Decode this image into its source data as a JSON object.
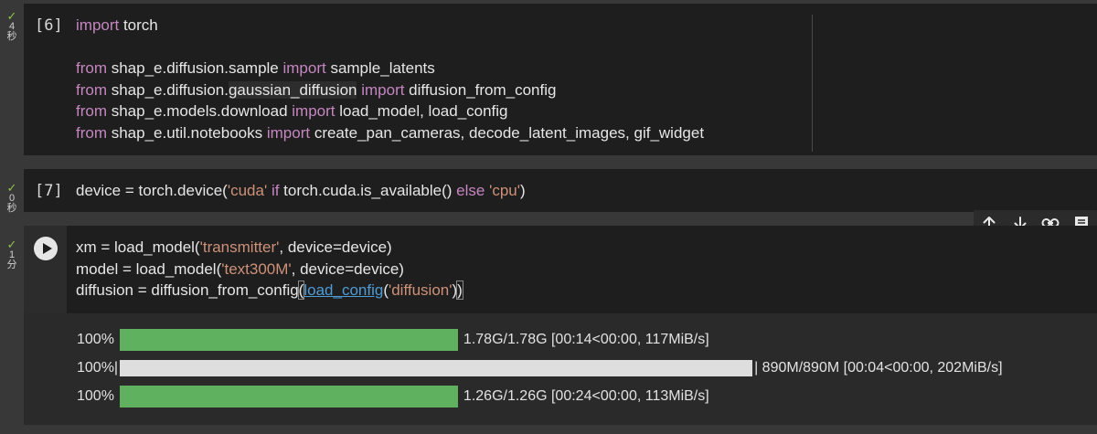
{
  "cells": [
    {
      "prompt": "[6]",
      "status": {
        "time": "4",
        "unit": "秒"
      },
      "lines": [
        [
          [
            "kw",
            "import"
          ],
          [
            "txt",
            " torch"
          ]
        ],
        [],
        [
          [
            "kw",
            "from"
          ],
          [
            "txt",
            " shap_e.diffusion.sample "
          ],
          [
            "kw",
            "import"
          ],
          [
            "txt",
            " sample_latents"
          ]
        ],
        [
          [
            "kw",
            "from"
          ],
          [
            "txt",
            " shap_e.diffusion."
          ],
          [
            "hl",
            "gaussian_diffusion"
          ],
          [
            "txt",
            " "
          ],
          [
            "kw",
            "import"
          ],
          [
            "txt",
            " diffusion_from_config"
          ]
        ],
        [
          [
            "kw",
            "from"
          ],
          [
            "txt",
            " shap_e.models.download "
          ],
          [
            "kw",
            "import"
          ],
          [
            "txt",
            " load_model, load_config"
          ]
        ],
        [
          [
            "kw",
            "from"
          ],
          [
            "txt",
            " shap_e.util.notebooks "
          ],
          [
            "kw",
            "import"
          ],
          [
            "txt",
            " create_pan_cameras, decode_latent_images, gif_widget"
          ]
        ]
      ]
    },
    {
      "prompt": "[7]",
      "status": {
        "time": "0",
        "unit": "秒"
      },
      "lines": [
        [
          [
            "txt",
            "device = torch.device("
          ],
          [
            "str",
            "'cuda'"
          ],
          [
            "txt",
            " "
          ],
          [
            "kw",
            "if"
          ],
          [
            "txt",
            " torch.cuda.is_available() "
          ],
          [
            "kw",
            "else"
          ],
          [
            "txt",
            " "
          ],
          [
            "str",
            "'cpu'"
          ],
          [
            "txt",
            ")"
          ]
        ]
      ]
    },
    {
      "prompt": "",
      "status": {
        "time": "1",
        "unit": "分"
      },
      "lines": [
        [
          [
            "txt",
            "xm = load_model("
          ],
          [
            "str",
            "'transmitter'"
          ],
          [
            "txt",
            ", device=device)"
          ]
        ],
        [
          [
            "txt",
            "model = load_model("
          ],
          [
            "str",
            "'text300M'"
          ],
          [
            "txt",
            ", device=device)"
          ]
        ],
        [
          [
            "txt",
            "diffusion = diffusion_from_config"
          ],
          [
            "br",
            "("
          ],
          [
            "link",
            "load_config"
          ],
          [
            "txt",
            "("
          ],
          [
            "str",
            "'diffusion'"
          ],
          [
            "txt",
            ")"
          ],
          [
            "br",
            ")"
          ]
        ]
      ]
    }
  ],
  "progress": [
    {
      "pct": "100%",
      "fraction": 1.0,
      "style": "green",
      "info": "1.78G/1.78G [00:14<00:00, 117MiB/s]"
    },
    {
      "pct": "100%|",
      "fraction": 1.0,
      "style": "white",
      "info": "| 890M/890M [00:04<00:00, 202MiB/s]"
    },
    {
      "pct": "100%",
      "fraction": 1.0,
      "style": "green",
      "info": "1.26G/1.26G [00:24<00:00, 113MiB/s]"
    }
  ],
  "toolbar": {
    "icons": [
      "arrow-up-icon",
      "arrow-down-icon",
      "link-icon",
      "comment-icon"
    ]
  },
  "colors": {
    "keyword": "#c586c0",
    "string": "#ce9178",
    "link": "#4e9bd6",
    "progress_green": "#5fb05f",
    "check": "#8bc34a"
  }
}
